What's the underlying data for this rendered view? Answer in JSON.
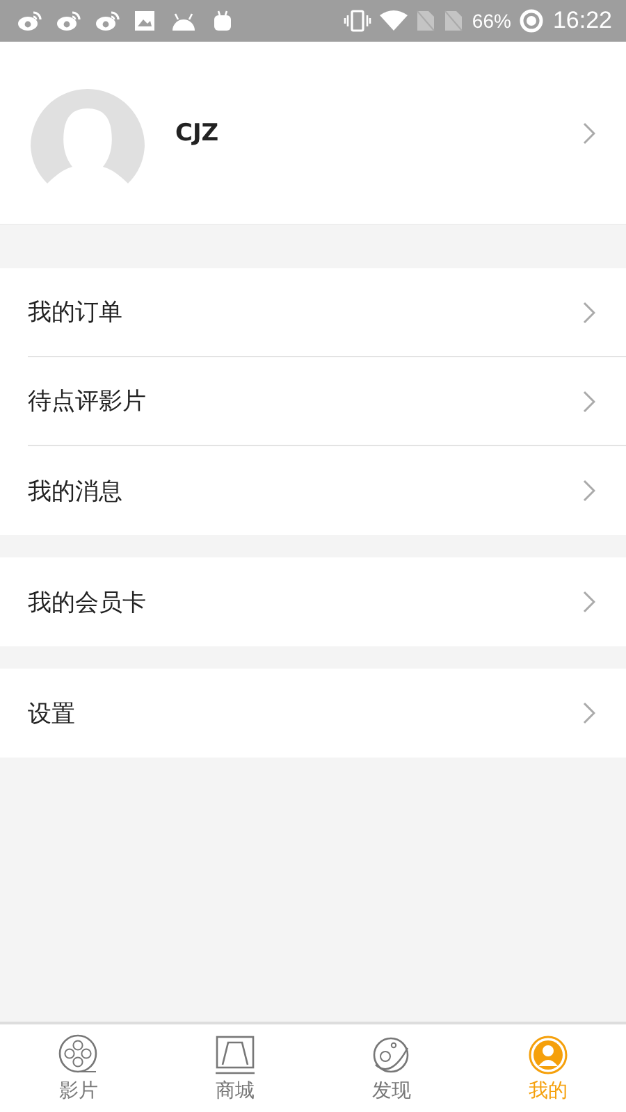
{
  "status_bar": {
    "battery": "66%",
    "time": "16:22"
  },
  "profile": {
    "name": "CJZ"
  },
  "menu_groups": [
    {
      "items": [
        {
          "label": "我的订单"
        },
        {
          "label": "待点评影片"
        },
        {
          "label": "我的消息"
        }
      ]
    },
    {
      "items": [
        {
          "label": "我的会员卡"
        }
      ]
    },
    {
      "items": [
        {
          "label": "设置"
        }
      ]
    }
  ],
  "tabs": [
    {
      "label": "影片",
      "kind": "film",
      "selected": false
    },
    {
      "label": "商城",
      "kind": "mall",
      "selected": false
    },
    {
      "label": "发现",
      "kind": "discover",
      "selected": false
    },
    {
      "label": "我的",
      "kind": "me",
      "selected": true
    }
  ]
}
